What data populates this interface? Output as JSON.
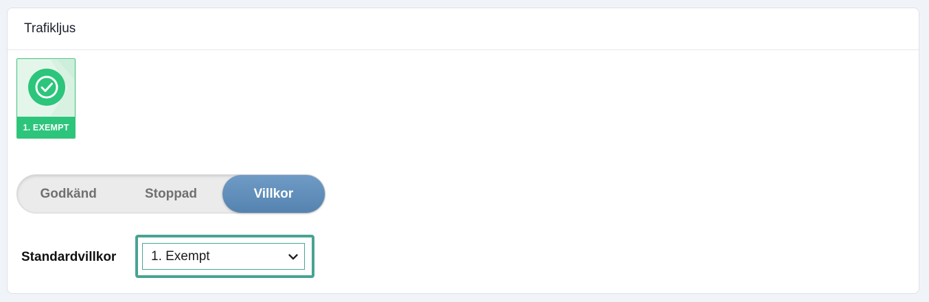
{
  "card": {
    "title": "Trafikljus"
  },
  "status_tile": {
    "label": "1. EXEMPT",
    "icon": "check-circle-icon",
    "color": "#2cc57b"
  },
  "segmented": {
    "options": [
      "Godkänd",
      "Stoppad",
      "Villkor"
    ],
    "selected": "Villkor",
    "selected_color": "#5f8fbd"
  },
  "standard_conditions": {
    "label": "Standardvillkor",
    "value": "1. Exempt",
    "focus_color": "#47a492"
  }
}
